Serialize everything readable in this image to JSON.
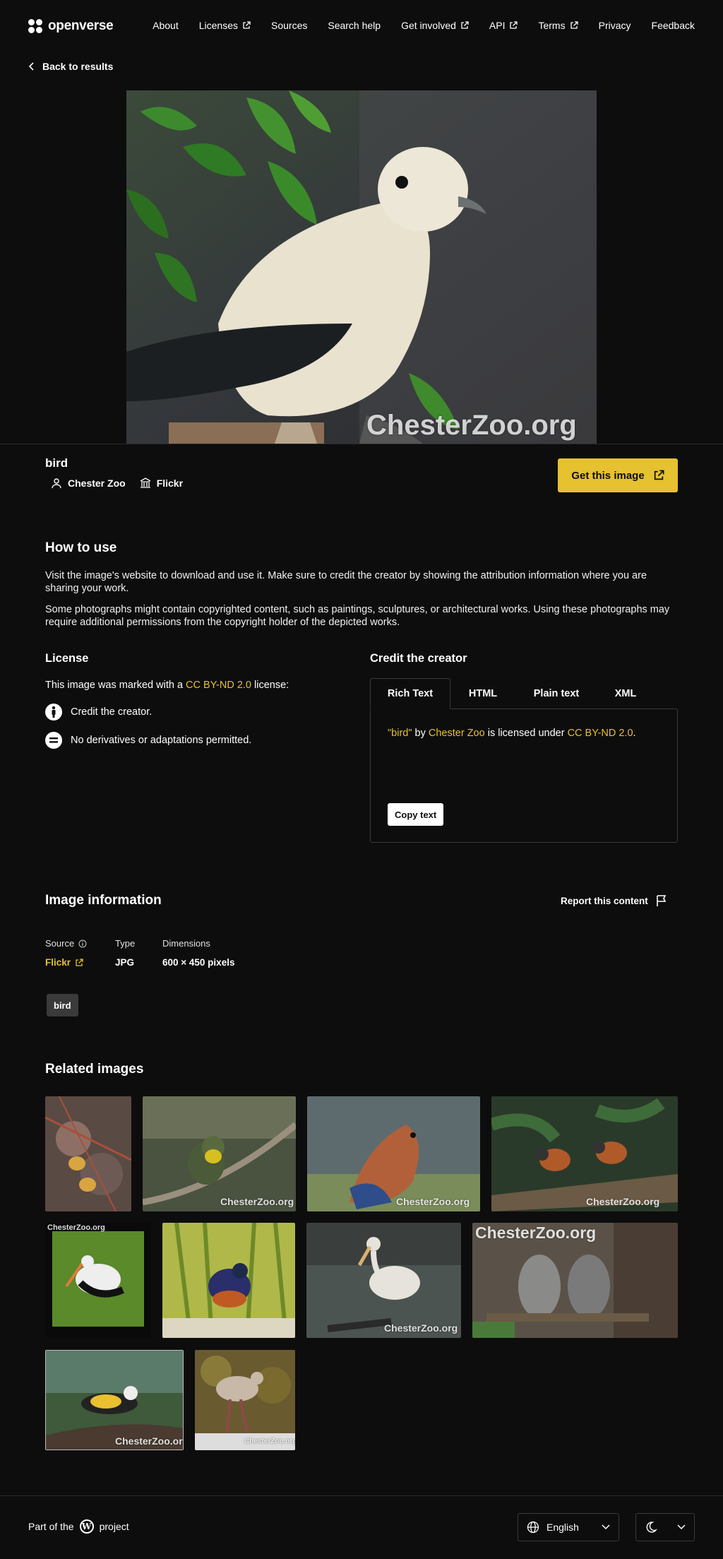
{
  "header": {
    "brand": "openverse",
    "nav": [
      {
        "label": "About",
        "external": false
      },
      {
        "label": "Licenses",
        "external": true
      },
      {
        "label": "Sources",
        "external": false
      },
      {
        "label": "Search help",
        "external": false
      },
      {
        "label": "Get involved",
        "external": true
      },
      {
        "label": "API",
        "external": true
      },
      {
        "label": "Terms",
        "external": true
      },
      {
        "label": "Privacy",
        "external": false
      },
      {
        "label": "Feedback",
        "external": false
      }
    ]
  },
  "back": {
    "label": "Back to results"
  },
  "image": {
    "title": "bird",
    "creator": "Chester Zoo",
    "source": "Flickr",
    "watermark": "ChesterZoo.org",
    "get_label": "Get this image"
  },
  "how_to_use": {
    "heading": "How to use",
    "p1": "Visit the image's website to download and use it. Make sure to credit the creator by showing the attribution information where you are sharing your work.",
    "p2": "Some photographs might contain copyrighted content, such as paintings, sculptures, or architectural works. Using these photographs may require additional permissions from the copyright holder of the depicted works."
  },
  "license": {
    "heading": "License",
    "prefix": "This image was marked with a",
    "name": "CC BY-ND 2.0",
    "suffix": "license:",
    "items": [
      "Credit the creator.",
      "No derivatives or adaptations permitted."
    ]
  },
  "credit": {
    "heading": "Credit the creator",
    "tabs": [
      "Rich Text",
      "HTML",
      "Plain text",
      "XML"
    ],
    "active_tab": "Rich Text",
    "text_open_quote": "\"",
    "text_title": "bird",
    "text_close_quote": "\"",
    "text_by": "by",
    "text_creator": "Chester Zoo",
    "text_licensed": "is licensed under",
    "text_license": "CC BY-ND 2.0",
    "text_period": ".",
    "copy_label": "Copy text"
  },
  "info": {
    "heading": "Image information",
    "report_label": "Report this content",
    "source_label": "Source",
    "source_value": "Flickr",
    "type_label": "Type",
    "type_value": "JPG",
    "dims_label": "Dimensions",
    "dims_value": "600 × 450 pixels",
    "tags": [
      "bird"
    ]
  },
  "related": {
    "heading": "Related images",
    "watermark": "ChesterZoo.org"
  },
  "footer": {
    "part_of": "Part of the",
    "project": "project",
    "language": "English"
  },
  "colors": {
    "accent": "#e6c130",
    "background": "#0d0d0d",
    "border": "#3a3a3a"
  }
}
